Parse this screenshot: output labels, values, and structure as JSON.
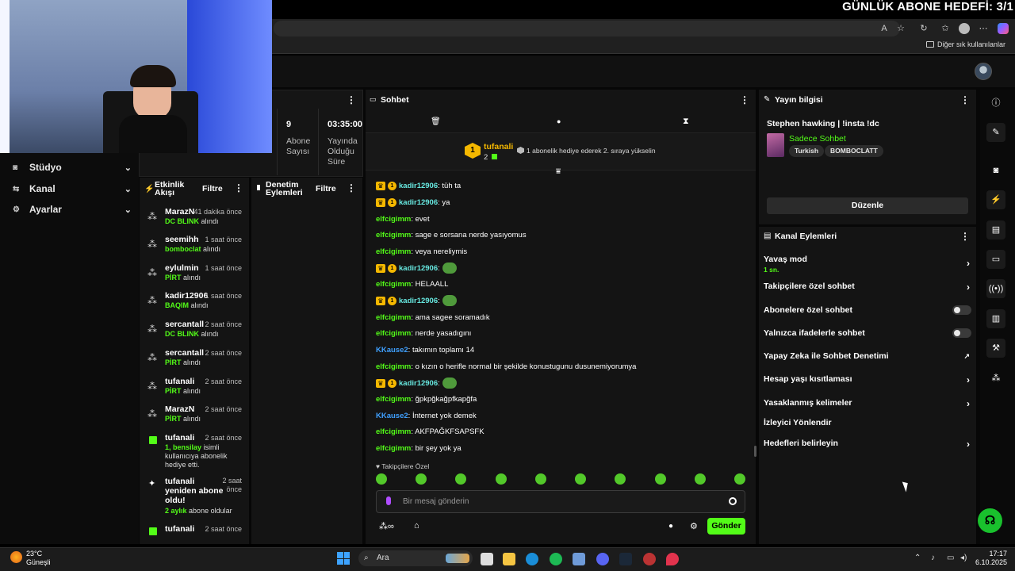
{
  "overlay": {
    "goal_text": "GÜNLÜK ABONE HEDEFİ: 3/1"
  },
  "browser": {
    "bookmarks_label": "Diğer sık kullanılanlar"
  },
  "nav": {
    "items": [
      {
        "label": "Stüdyo"
      },
      {
        "label": "Kanal"
      },
      {
        "label": "Ayarlar"
      }
    ]
  },
  "stats": {
    "subs_value": "9",
    "subs_label1": "Abone",
    "subs_label2": "Sayısı",
    "stream_time": "03:35:00",
    "stream_label1": "Yayında",
    "stream_label2": "Olduğu",
    "stream_label3": "Süre"
  },
  "activity": {
    "title1": "Etkinlik",
    "title2": "Akışı",
    "filter": "Filtre",
    "items": [
      {
        "name": "MarazN",
        "time": "41 dakika önce",
        "item": "DC BLINK",
        "suffix": "alındı"
      },
      {
        "name": "seemihh",
        "time": "1 saat önce",
        "item": "bomboclat",
        "suffix": "alındı"
      },
      {
        "name": "eylulmin",
        "time": "1 saat önce",
        "item": "PİRT",
        "suffix": "alındı"
      },
      {
        "name": "kadir12906",
        "time": "1 saat önce",
        "item": "BAQIM",
        "suffix": "alındı"
      },
      {
        "name": "sercantall",
        "time": "2 saat önce",
        "item": "DC BLINK",
        "suffix": "alındı"
      },
      {
        "name": "sercantall",
        "time": "2 saat önce",
        "item": "PİRT",
        "suffix": "alındı"
      },
      {
        "name": "tufanali",
        "time": "2 saat önce",
        "item": "PİRT",
        "suffix": "alındı"
      },
      {
        "name": "MarazN",
        "time": "2 saat önce",
        "item": "PİRT",
        "suffix": "alındı"
      }
    ],
    "gift": {
      "name": "tufanali",
      "time": "2 saat önce",
      "line1a": "1, bensilay",
      "line1b": "isimli",
      "line2": "kullanıcıya abonelik",
      "line3": "hediye etti."
    },
    "resub": {
      "name1": "tufanali",
      "name2": "yeniden abone",
      "name3": "oldu!",
      "time1": "2 saat",
      "time2": "önce",
      "months": "2 aylık",
      "rest": "abone oldular"
    },
    "last": {
      "name": "tufanali",
      "time": "2 saat önce"
    }
  },
  "mod": {
    "title1": "Denetim",
    "title2": "Eylemleri",
    "filter": "Filtre"
  },
  "chat": {
    "title": "Sohbet",
    "pinned_user": "tufanali",
    "pinned_count": "2",
    "pinned_rank": "1",
    "pinned_text": "1 abonelik hediye ederek 2. sıraya yükselin",
    "messages": [
      {
        "user": "kadir12906",
        "text": ": tüh ta",
        "badges": true,
        "color": "teal"
      },
      {
        "user": "kadir12906",
        "text": ": ya",
        "badges": true,
        "color": "teal"
      },
      {
        "user": "elfcigimm",
        "text": ": evet",
        "badges": false,
        "color": "green"
      },
      {
        "user": "elfcigimm",
        "text": ": sage e sorsana nerde yasıyomus",
        "badges": false,
        "color": "green"
      },
      {
        "user": "elfcigimm",
        "text": ": veya nereliymis",
        "badges": false,
        "color": "green"
      },
      {
        "user": "kadir12906",
        "text": ":",
        "badges": true,
        "color": "teal",
        "emote": true
      },
      {
        "user": "elfcigimm",
        "text": ": HELAALL",
        "badges": false,
        "color": "green"
      },
      {
        "user": "kadir12906",
        "text": ":",
        "badges": true,
        "color": "teal",
        "emote": true
      },
      {
        "user": "elfcigimm",
        "text": ": ama sagee soramadık",
        "badges": false,
        "color": "green"
      },
      {
        "user": "elfcigimm",
        "text": ": nerde yasadıgını",
        "badges": false,
        "color": "green"
      },
      {
        "user": "KKause2",
        "text": ": takımın toplamı 14",
        "badges": false,
        "color": "blue"
      },
      {
        "user": "elfcigimm",
        "text": ": o kızın o herifle normal bir şekilde konustugunu dusunemiyorumya",
        "badges": false,
        "color": "green"
      },
      {
        "user": "kadir12906",
        "text": ":",
        "badges": true,
        "color": "teal",
        "emote": true
      },
      {
        "user": "elfcigimm",
        "text": ": ğpkpğkağpfkapğfa",
        "badges": false,
        "color": "green"
      },
      {
        "user": "KKause2",
        "text": ": İnternet yok demek",
        "badges": false,
        "color": "blue"
      },
      {
        "user": "elfcigimm",
        "text": ": AKFPAĞKFSAPSFK",
        "badges": false,
        "color": "green"
      },
      {
        "user": "elfcigimm",
        "text": ": bir şey yok ya",
        "badges": false,
        "color": "green"
      }
    ],
    "followers_label": "Takipçilere Özel",
    "input_placeholder": "Bir mesaj gönderin",
    "send_label": "Gönder"
  },
  "info": {
    "title": "Yayın bilgisi",
    "stream_title": "Stephen hawking | !insta !dc",
    "category": "Sadece Sohbet",
    "tags": [
      "Turkish",
      "BOMBOCLATT"
    ],
    "edit_label": "Düzenle"
  },
  "channel": {
    "title": "Kanal Eylemleri",
    "slow_mode": "Yavaş mod",
    "slow_value": "1 sn.",
    "followers_only": "Takipçilere özel sohbet",
    "subs_only": "Abonelere özel sohbet",
    "emotes_only": "Yalnızca ifadelerle sohbet",
    "ai_mod": "Yapay Zeka ile Sohbet Denetimi",
    "age_limit": "Hesap yaşı kısıtlaması",
    "banned_words": "Yasaklanmış kelimeler",
    "raid": "İzleyici Yönlendir",
    "goals": "Hedefleri belirleyin"
  },
  "taskbar": {
    "temp": "23°C",
    "weather": "Güneşli",
    "search": "Ara",
    "time": "17:17",
    "date": "6.10.2025"
  },
  "colors": {
    "accent": "#53fc18",
    "badge": "#f5b800",
    "panel": "#141414"
  }
}
